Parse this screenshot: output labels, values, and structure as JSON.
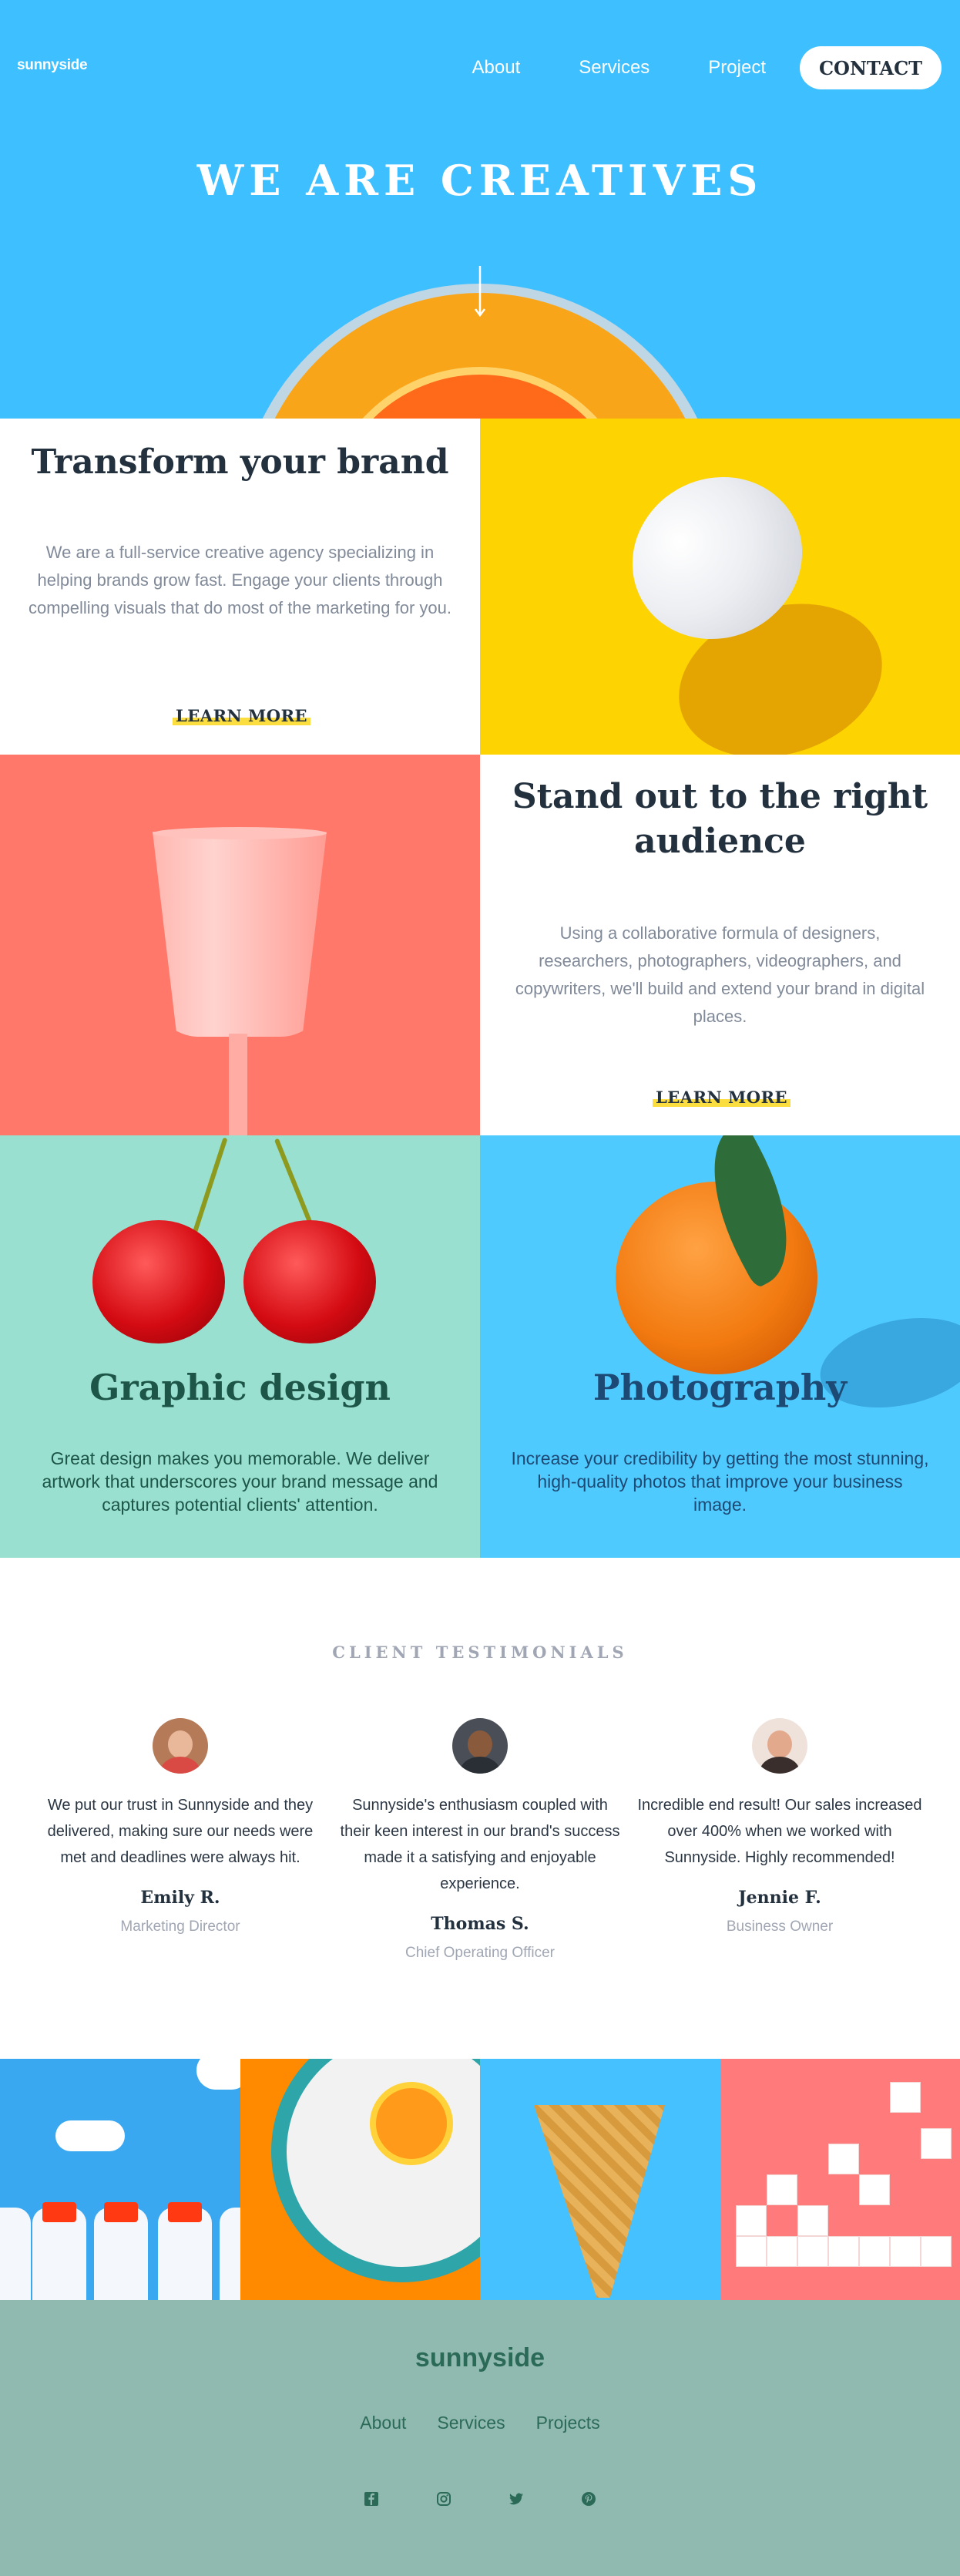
{
  "brand": {
    "logo": "sunnyside"
  },
  "nav": {
    "about": "About",
    "services": "Services",
    "project": "Project",
    "contact": "CONTACT"
  },
  "hero": {
    "title": "WE ARE CREATIVES",
    "icons": [
      "arrow-down-icon"
    ]
  },
  "features": [
    {
      "title": "Transform your brand",
      "text": "We are a full-service creative agency specializing in helping brands grow fast. Engage your clients through compelling visuals that do most of the marketing for you.",
      "link": "LEARN MORE"
    },
    {
      "title": "Stand out to the right audience",
      "text": "Using a collaborative formula of designers, researchers, photographers, videographers, and copywriters, we'll build and extend your brand in digital places.",
      "link": "LEARN MORE"
    }
  ],
  "services": [
    {
      "title": "Graphic design",
      "text": "Great design makes you memorable. We deliver artwork that underscores your brand message and captures potential clients' attention."
    },
    {
      "title": "Photography",
      "text": "Increase your credibility by getting the most stunning, high-quality photos that improve your business image."
    }
  ],
  "testimonials": {
    "heading": "CLIENT TESTIMONIALS",
    "items": [
      {
        "quote": "We put our trust in Sunnyside and they delivered, making sure our needs were met and deadlines were always hit.",
        "name": "Emily R.",
        "role": "Marketing Director"
      },
      {
        "quote": "Sunnyside's enthusiasm coupled with their keen interest in our brand's success made it a satisfying and enjoyable experience.",
        "name": "Thomas S.",
        "role": "Chief Operating Officer"
      },
      {
        "quote": "Incredible end result! Our sales increased over 400% when we worked with Sunnyside. Highly recommended!",
        "name": "Jennie F.",
        "role": "Business Owner"
      }
    ]
  },
  "footer": {
    "logo": "sunnyside",
    "nav": [
      "About",
      "Services",
      "Projects"
    ],
    "social_icons": [
      "facebook-icon",
      "instagram-icon",
      "twitter-icon",
      "pinterest-icon"
    ]
  },
  "colors": {
    "hero_blue": "#3ebfff",
    "yellow": "#fdd302",
    "coral": "#ff7869",
    "mint": "#99e0d0",
    "sky": "#4fcaff",
    "footer": "#90bab0",
    "dark": "#23303e"
  }
}
